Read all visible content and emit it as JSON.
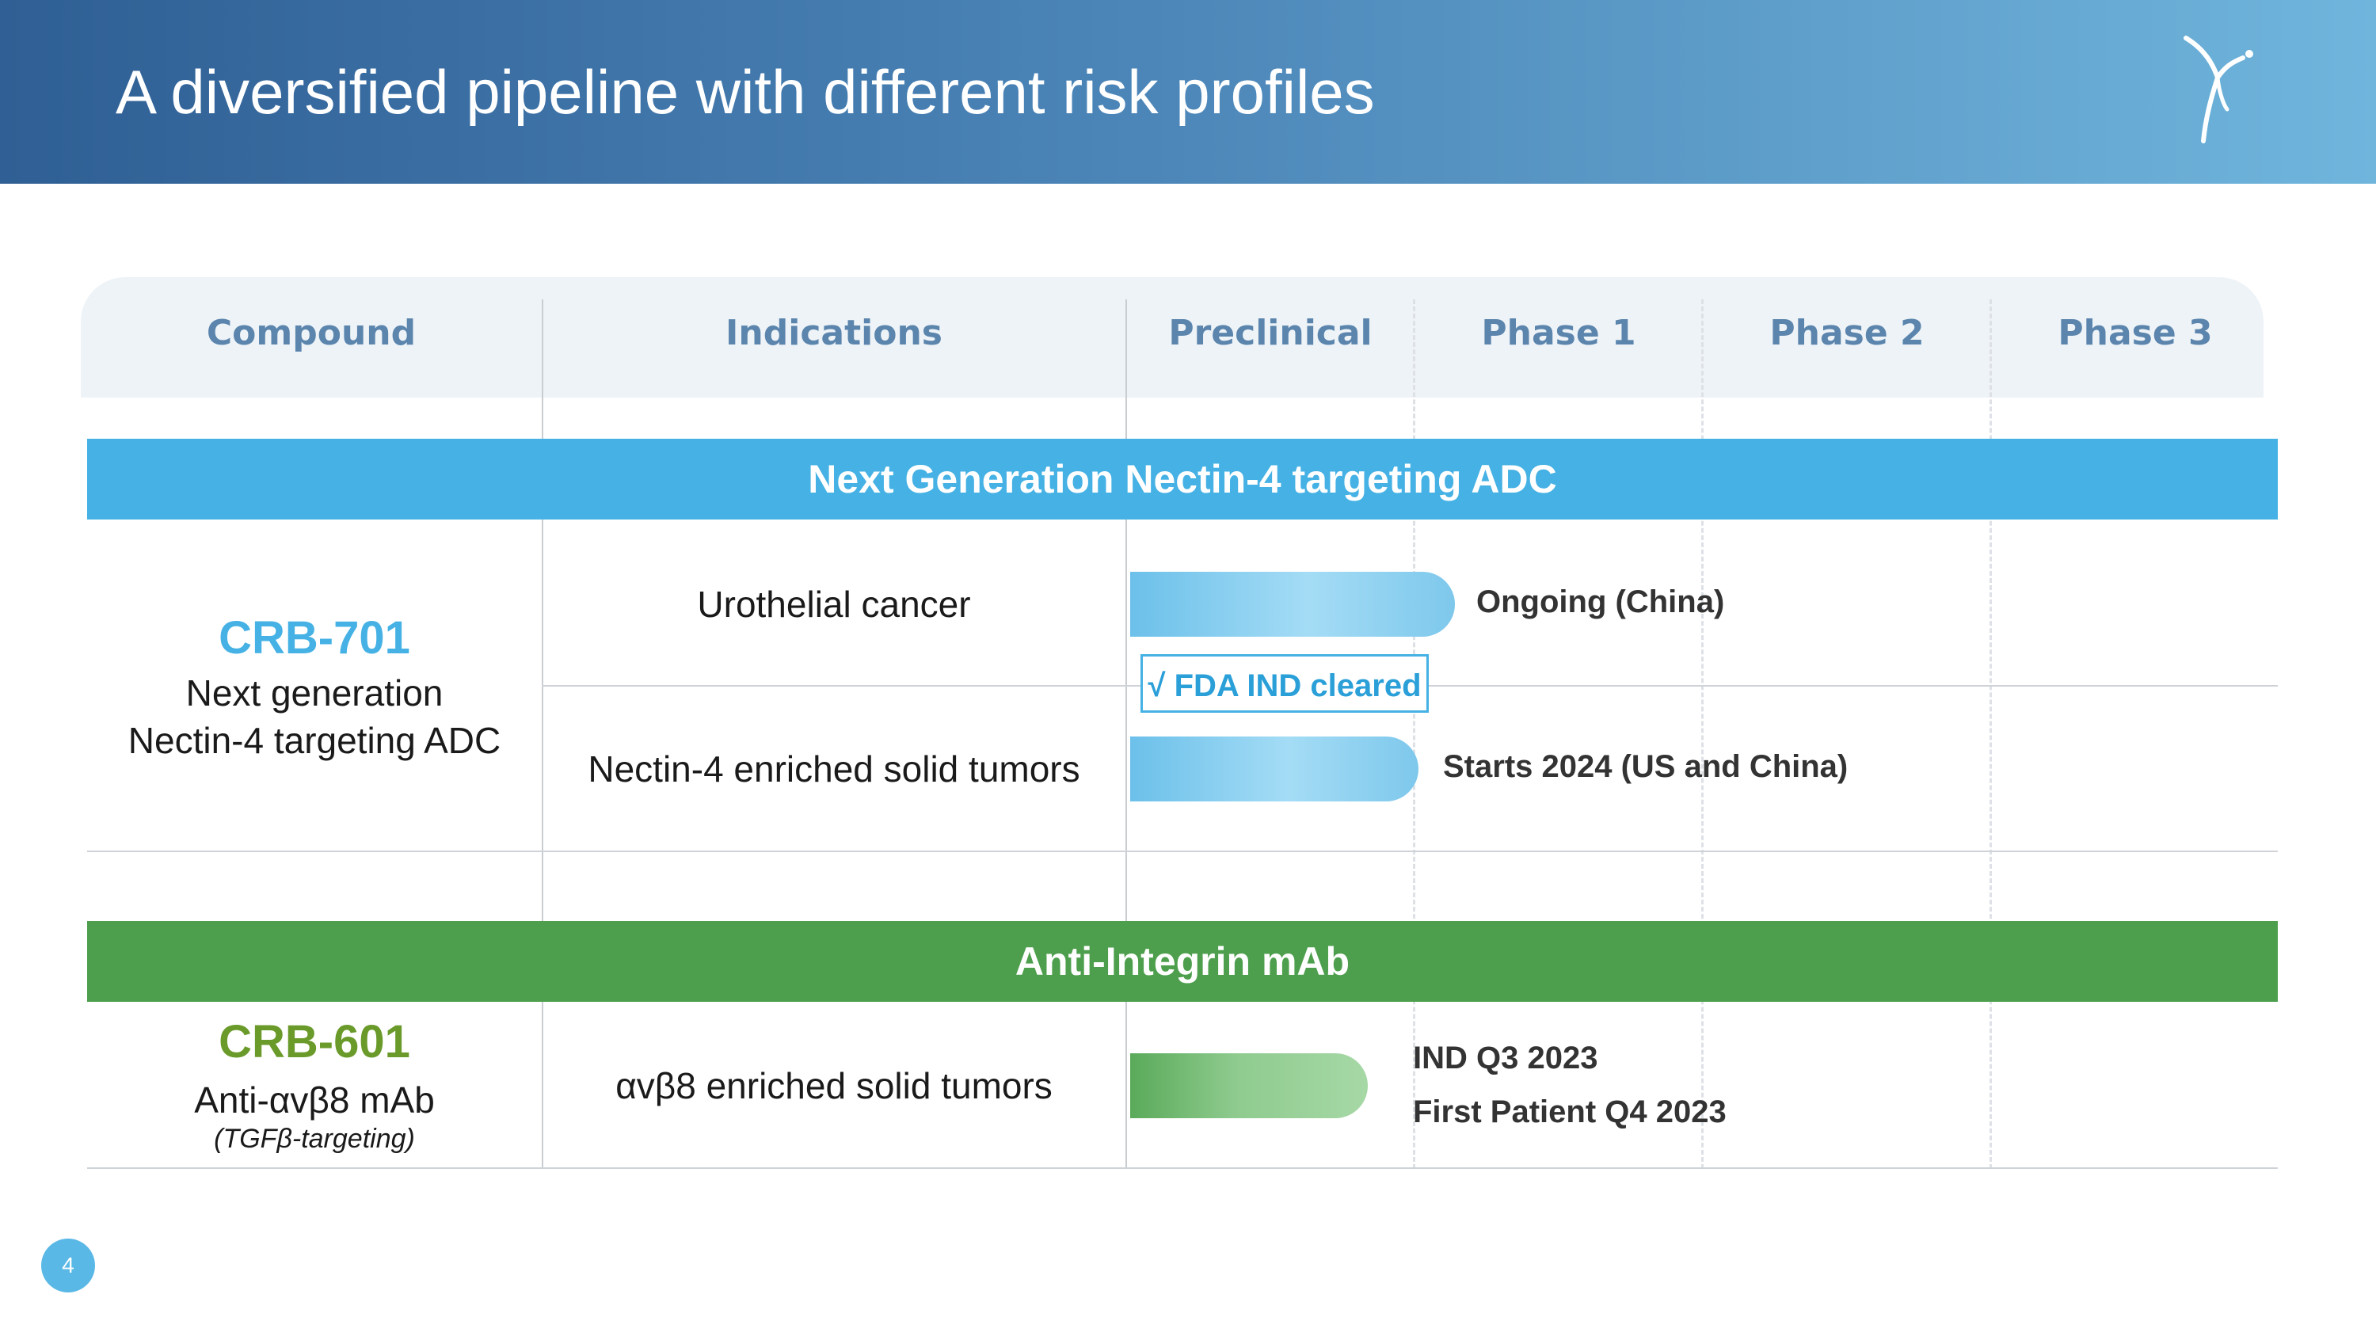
{
  "header": {
    "title": "A diversified pipeline with different risk profiles",
    "logo_icon": "figure-star-logo-icon"
  },
  "columns": [
    "Compound",
    "Indications",
    "Preclinical",
    "Phase 1",
    "Phase 2",
    "Phase 3"
  ],
  "sections": [
    {
      "band_label": "Next Generation Nectin-4 targeting ADC",
      "band_color": "#45b1e4",
      "compound": {
        "name": "CRB-701",
        "name_color": "#45b1e4",
        "desc_line1": "Next generation",
        "desc_line2": "Nectin-4 targeting ADC"
      },
      "rows": [
        {
          "indication": "Urothelial cancer",
          "note": "Ongoing (China)"
        },
        {
          "indication": "Nectin-4 enriched solid tumors",
          "note": "Starts 2024 (US and China)"
        }
      ],
      "badge": "√  FDA IND cleared"
    },
    {
      "band_label": "Anti-Integrin mAb",
      "band_color": "#4d9f4d",
      "compound": {
        "name": "CRB-601",
        "name_color": "#6a9a2a",
        "desc_line1": "Anti-αvβ8 mAb",
        "desc_line2": "(TGFβ-targeting)"
      },
      "rows": [
        {
          "indication": "αvβ8 enriched solid tumors",
          "note_line1": "IND Q3 2023",
          "note_line2": "First Patient Q4 2023"
        }
      ]
    }
  ],
  "page_number": "4"
}
